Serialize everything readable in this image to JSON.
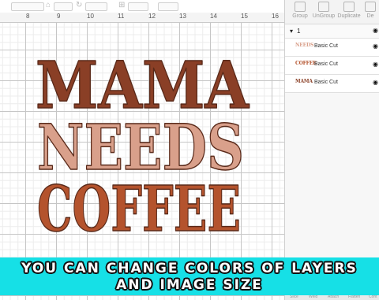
{
  "toolbar": {
    "icons": [
      "lock-icon",
      "rotate-icon",
      "position-icon"
    ]
  },
  "ruler": {
    "ticks": [
      "8",
      "9",
      "10",
      "11",
      "12",
      "13",
      "14",
      "15",
      "16"
    ]
  },
  "design": {
    "line1": "MAMA",
    "line2": "NEEDS",
    "line3": "COFFEE",
    "colors": {
      "line1": "#8a3f26",
      "line2": "#d9a08b",
      "line3": "#b4532d",
      "outline": "#5a2a1a"
    }
  },
  "panel": {
    "tools": [
      "Group",
      "UnGroup",
      "Duplicate",
      "De"
    ],
    "group": {
      "label": "1"
    },
    "layers": [
      {
        "thumb": "NEEDS",
        "name": "Basic Cut",
        "color": "#d9a08b"
      },
      {
        "thumb": "COFFEE",
        "name": "Basic Cut",
        "color": "#b4532d"
      },
      {
        "thumb": "MAMA",
        "name": "Basic Cut",
        "color": "#8a3f26"
      }
    ],
    "bottom": [
      "Slice",
      "Weld",
      "Attach",
      "Flatten",
      "Cont"
    ]
  },
  "banner": {
    "line1": "YOU CAN CHANGE COLORS OF LAYERS",
    "line2": "AND IMAGE SIZE",
    "background": "#16e0e6"
  }
}
